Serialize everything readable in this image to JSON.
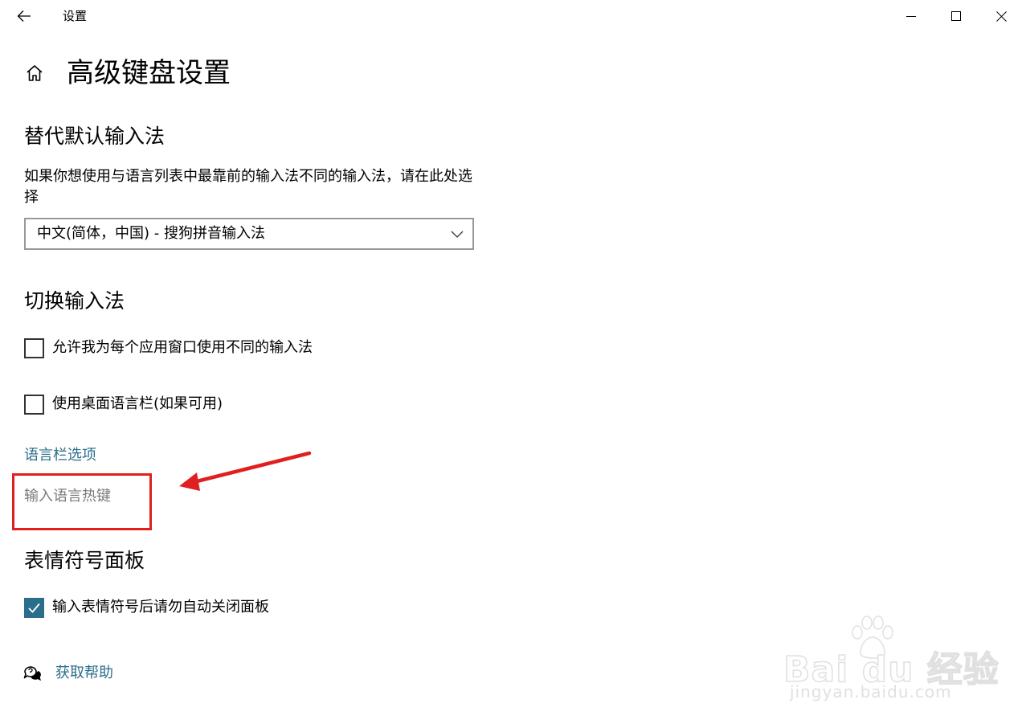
{
  "app": {
    "title": "设置"
  },
  "page": {
    "title": "高级键盘设置"
  },
  "sections": {
    "default_ime": {
      "heading": "替代默认输入法",
      "description": "如果你想使用与语言列表中最靠前的输入法不同的输入法，请在此处选择",
      "dropdown_value": "中文(简体，中国) - 搜狗拼音输入法"
    },
    "switch_ime": {
      "heading": "切换输入法",
      "options": [
        {
          "label": "允许我为每个应用窗口使用不同的输入法",
          "checked": false
        },
        {
          "label": "使用桌面语言栏(如果可用)",
          "checked": false
        }
      ],
      "language_bar_link": "语言栏选项",
      "hotkeys_link": "输入语言热键"
    },
    "emoji": {
      "heading": "表情符号面板",
      "option": {
        "label": "输入表情符号后请勿自动关闭面板",
        "checked": true
      }
    }
  },
  "help": {
    "label": "获取帮助"
  },
  "watermark": {
    "brand": "Bai du 经验",
    "url": "jingyan.baidu.com"
  },
  "colors": {
    "accent": "#2b6e8c",
    "annotation": "#e02020",
    "disabled_text": "#7a7a7a"
  }
}
